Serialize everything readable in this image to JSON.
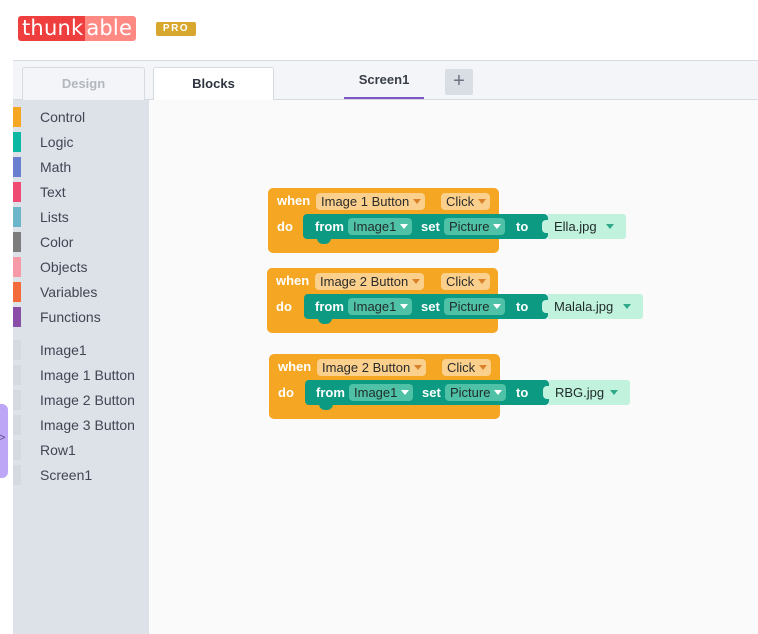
{
  "header": {
    "logo_part1": "thunk",
    "logo_part2": "able",
    "badge": "PRO"
  },
  "tabs": {
    "design": "Design",
    "blocks": "Blocks",
    "screen": "Screen1",
    "add": "+"
  },
  "sidebar": {
    "categories": [
      {
        "label": "Control",
        "color": "#f5a623"
      },
      {
        "label": "Logic",
        "color": "#0ab8a4"
      },
      {
        "label": "Math",
        "color": "#6a7fd0"
      },
      {
        "label": "Text",
        "color": "#ef4a73"
      },
      {
        "label": "Lists",
        "color": "#6db6c9"
      },
      {
        "label": "Color",
        "color": "#7d7d7d"
      },
      {
        "label": "Objects",
        "color": "#f79aa8"
      },
      {
        "label": "Variables",
        "color": "#f36b3b"
      },
      {
        "label": "Functions",
        "color": "#8a4ea8"
      }
    ],
    "components": [
      {
        "label": "Image1"
      },
      {
        "label": "Image 1 Button"
      },
      {
        "label": "Image 2 Button"
      },
      {
        "label": "Image 3 Button"
      },
      {
        "label": "Row1"
      },
      {
        "label": "Screen1"
      }
    ],
    "expand_icon": ">"
  },
  "blocks": [
    {
      "when": "when",
      "component": "Image 1 Button",
      "event": "Click",
      "do": "do",
      "from": "from",
      "target": "Image1",
      "set": "set",
      "property": "Picture",
      "to": "to",
      "value": "Ella.jpg"
    },
    {
      "when": "when",
      "component": "Image 2 Button",
      "event": "Click",
      "do": "do",
      "from": "from",
      "target": "Image1",
      "set": "set",
      "property": "Picture",
      "to": "to",
      "value": "Malala.jpg"
    },
    {
      "when": "when",
      "component": "Image 2 Button",
      "event": "Click",
      "do": "do",
      "from": "from",
      "target": "Image1",
      "set": "set",
      "property": "Picture",
      "to": "to",
      "value": "RBG.jpg"
    }
  ],
  "colors": {
    "event_block": "#f5a623",
    "setter_block": "#0c9b82",
    "value_block": "#c1f2de",
    "accent": "#7e57c2"
  }
}
